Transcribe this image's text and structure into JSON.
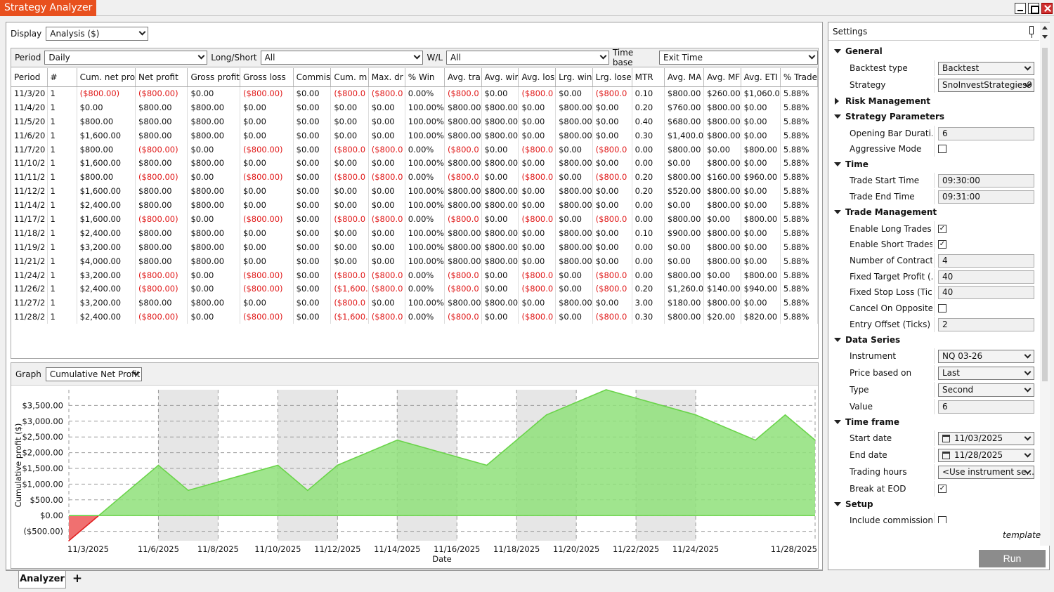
{
  "window": {
    "title": "Strategy Analyzer"
  },
  "display": {
    "label": "Display",
    "value": "Analysis ($)"
  },
  "filters": {
    "period_label": "Period",
    "period_value": "Daily",
    "longshort_label": "Long/Short",
    "longshort_value": "All",
    "wl_label": "W/L",
    "wl_value": "All",
    "timebase_label": "Time base",
    "timebase_value": "Exit Time"
  },
  "table": {
    "columns": [
      "Period",
      "#",
      "Cum. net pro",
      "Net profit",
      "Gross profit",
      "Gross loss",
      "Commis",
      "Cum. m",
      "Max. dr",
      "% Win",
      "Avg. tra",
      "Avg. wir",
      "Avg. los",
      "Lrg. win",
      "Lrg. lose",
      "MTR",
      "Avg. MA",
      "Avg. MF",
      "Avg. ETI",
      "% Trade"
    ],
    "rows": [
      [
        "11/3/20",
        "1",
        "($800.00)",
        "($800.00)",
        "$0.00",
        "($800.00)",
        "$0.00",
        "($800.0",
        "($800.0",
        "0.00%",
        "($800.0",
        "$0.00",
        "($800.0",
        "$0.00",
        "($800.0",
        "0.10",
        "$800.00",
        "$260.00",
        "$1,060.0",
        "5.88%"
      ],
      [
        "11/4/20",
        "1",
        "$0.00",
        "$800.00",
        "$800.00",
        "$0.00",
        "$0.00",
        "$0.00",
        "$0.00",
        "100.00%",
        "$800.00",
        "$800.00",
        "$0.00",
        "$800.00",
        "$0.00",
        "0.20",
        "$760.00",
        "$800.00",
        "$0.00",
        "5.88%"
      ],
      [
        "11/5/20",
        "1",
        "$800.00",
        "$800.00",
        "$800.00",
        "$0.00",
        "$0.00",
        "$0.00",
        "$0.00",
        "100.00%",
        "$800.00",
        "$800.00",
        "$0.00",
        "$800.00",
        "$0.00",
        "0.40",
        "$680.00",
        "$800.00",
        "$0.00",
        "5.88%"
      ],
      [
        "11/6/20",
        "1",
        "$1,600.00",
        "$800.00",
        "$800.00",
        "$0.00",
        "$0.00",
        "$0.00",
        "$0.00",
        "100.00%",
        "$800.00",
        "$800.00",
        "$0.00",
        "$800.00",
        "$0.00",
        "0.30",
        "$1,400.0",
        "$800.00",
        "$0.00",
        "5.88%"
      ],
      [
        "11/7/20",
        "1",
        "$800.00",
        "($800.00)",
        "$0.00",
        "($800.00)",
        "$0.00",
        "($800.0",
        "($800.0",
        "0.00%",
        "($800.0",
        "$0.00",
        "($800.0",
        "$0.00",
        "($800.0",
        "0.00",
        "$800.00",
        "$0.00",
        "$800.00",
        "5.88%"
      ],
      [
        "11/10/2",
        "1",
        "$1,600.00",
        "$800.00",
        "$800.00",
        "$0.00",
        "$0.00",
        "$0.00",
        "$0.00",
        "100.00%",
        "$800.00",
        "$800.00",
        "$0.00",
        "$800.00",
        "$0.00",
        "0.00",
        "$0.00",
        "$800.00",
        "$0.00",
        "5.88%"
      ],
      [
        "11/11/2",
        "1",
        "$800.00",
        "($800.00)",
        "$0.00",
        "($800.00)",
        "$0.00",
        "($800.0",
        "($800.0",
        "0.00%",
        "($800.0",
        "$0.00",
        "($800.0",
        "$0.00",
        "($800.0",
        "0.20",
        "$800.00",
        "$160.00",
        "$960.00",
        "5.88%"
      ],
      [
        "11/12/2",
        "1",
        "$1,600.00",
        "$800.00",
        "$800.00",
        "$0.00",
        "$0.00",
        "$0.00",
        "$0.00",
        "100.00%",
        "$800.00",
        "$800.00",
        "$0.00",
        "$800.00",
        "$0.00",
        "0.20",
        "$520.00",
        "$800.00",
        "$0.00",
        "5.88%"
      ],
      [
        "11/14/2",
        "1",
        "$2,400.00",
        "$800.00",
        "$800.00",
        "$0.00",
        "$0.00",
        "$0.00",
        "$0.00",
        "100.00%",
        "$800.00",
        "$800.00",
        "$0.00",
        "$800.00",
        "$0.00",
        "0.00",
        "$0.00",
        "$800.00",
        "$0.00",
        "5.88%"
      ],
      [
        "11/17/2",
        "1",
        "$1,600.00",
        "($800.00)",
        "$0.00",
        "($800.00)",
        "$0.00",
        "($800.0",
        "($800.0",
        "0.00%",
        "($800.0",
        "$0.00",
        "($800.0",
        "$0.00",
        "($800.0",
        "0.00",
        "$800.00",
        "$0.00",
        "$800.00",
        "5.88%"
      ],
      [
        "11/18/2",
        "1",
        "$2,400.00",
        "$800.00",
        "$800.00",
        "$0.00",
        "$0.00",
        "$0.00",
        "$0.00",
        "100.00%",
        "$800.00",
        "$800.00",
        "$0.00",
        "$800.00",
        "$0.00",
        "0.10",
        "$900.00",
        "$800.00",
        "$0.00",
        "5.88%"
      ],
      [
        "11/19/2",
        "1",
        "$3,200.00",
        "$800.00",
        "$800.00",
        "$0.00",
        "$0.00",
        "$0.00",
        "$0.00",
        "100.00%",
        "$800.00",
        "$800.00",
        "$0.00",
        "$800.00",
        "$0.00",
        "0.00",
        "$0.00",
        "$800.00",
        "$0.00",
        "5.88%"
      ],
      [
        "11/21/2",
        "1",
        "$4,000.00",
        "$800.00",
        "$800.00",
        "$0.00",
        "$0.00",
        "$0.00",
        "$0.00",
        "100.00%",
        "$800.00",
        "$800.00",
        "$0.00",
        "$800.00",
        "$0.00",
        "0.00",
        "$0.00",
        "$800.00",
        "$0.00",
        "5.88%"
      ],
      [
        "11/24/2",
        "1",
        "$3,200.00",
        "($800.00)",
        "$0.00",
        "($800.00)",
        "$0.00",
        "($800.0",
        "($800.0",
        "0.00%",
        "($800.0",
        "$0.00",
        "($800.0",
        "$0.00",
        "($800.0",
        "0.00",
        "$800.00",
        "$0.00",
        "$800.00",
        "5.88%"
      ],
      [
        "11/26/2",
        "1",
        "$2,400.00",
        "($800.00)",
        "$0.00",
        "($800.00)",
        "$0.00",
        "($1,600.",
        "($800.0",
        "0.00%",
        "($800.0",
        "$0.00",
        "($800.0",
        "$0.00",
        "($800.0",
        "0.20",
        "$1,260.0",
        "$140.00",
        "$940.00",
        "5.88%"
      ],
      [
        "11/27/2",
        "1",
        "$3,200.00",
        "$800.00",
        "$800.00",
        "$0.00",
        "$0.00",
        "($800.0",
        "$0.00",
        "100.00%",
        "$800.00",
        "$800.00",
        "$0.00",
        "$800.00",
        "$0.00",
        "3.00",
        "$180.00",
        "$800.00",
        "$0.00",
        "5.88%"
      ],
      [
        "11/28/2",
        "1",
        "$2,400.00",
        "($800.00)",
        "$0.00",
        "($800.00)",
        "$0.00",
        "($1,600.",
        "($800.0",
        "0.00%",
        "($800.0",
        "$0.00",
        "($800.0",
        "$0.00",
        "($800.0",
        "0.30",
        "$800.00",
        "$20.00",
        "$820.00",
        "5.88%"
      ]
    ]
  },
  "graph": {
    "label": "Graph",
    "value": "Cumulative Net Profit"
  },
  "chart_data": {
    "type": "area",
    "ylabel": "Cumulative profit ($)",
    "xlabel": "Date",
    "x": [
      "11/3/2025",
      "11/4/2025",
      "11/5/2025",
      "11/6/2025",
      "11/7/2025",
      "11/10/2025",
      "11/11/2025",
      "11/12/2025",
      "11/14/2025",
      "11/17/2025",
      "11/18/2025",
      "11/19/2025",
      "11/21/2025",
      "11/24/2025",
      "11/26/2025",
      "11/27/2025",
      "11/28/2025"
    ],
    "values": [
      -800,
      0,
      800,
      1600,
      800,
      1600,
      800,
      1600,
      2400,
      1600,
      2400,
      3200,
      4000,
      3200,
      2400,
      3200,
      2400
    ],
    "x_tick_labels": [
      "11/3/2025",
      "11/6/2025",
      "11/8/2025",
      "11/10/2025",
      "11/12/2025",
      "11/14/2025",
      "11/16/2025",
      "11/18/2025",
      "11/20/2025",
      "11/22/2025",
      "11/24/2025",
      "11/28/2025"
    ],
    "y_tick_labels": [
      "$3,500.00",
      "$3,000.00",
      "$2,500.00",
      "$2,000.00",
      "$1,500.00",
      "$1,000.00",
      "$500.00",
      "$0.00",
      "($500.00)"
    ],
    "y_ticks": [
      3500,
      3000,
      2500,
      2000,
      1500,
      1000,
      500,
      0,
      -500
    ],
    "ylim": [
      -800,
      4000
    ],
    "grid": true,
    "positive_color": "#8fe07a",
    "positive_line": "#6ad44a",
    "negative_color": "#f07070",
    "negative_line": "#e02020",
    "shade_color": "#e6e6e6"
  },
  "tabs": {
    "analyzer": "Analyzer",
    "add": "+"
  },
  "settings": {
    "title": "Settings",
    "template_label": "template",
    "run_label": "Run",
    "items": [
      {
        "kind": "section",
        "label": "General"
      },
      {
        "kind": "combo",
        "label": "Backtest type",
        "value": "Backtest"
      },
      {
        "kind": "combo",
        "label": "Strategy",
        "value": "SnoInvestStrategies9"
      },
      {
        "kind": "section-collapsed",
        "label": "Risk Management"
      },
      {
        "kind": "section",
        "label": "Strategy Parameters"
      },
      {
        "kind": "text",
        "label": "Opening Bar Durati...",
        "value": "6"
      },
      {
        "kind": "check",
        "label": "Aggressive Mode",
        "value": ""
      },
      {
        "kind": "section",
        "label": "Time"
      },
      {
        "kind": "text",
        "label": "Trade Start Time",
        "value": "09:30:00"
      },
      {
        "kind": "text",
        "label": "Trade End Time",
        "value": "09:31:00"
      },
      {
        "kind": "section",
        "label": "Trade Management"
      },
      {
        "kind": "check",
        "label": "Enable Long Trades",
        "value": "✓"
      },
      {
        "kind": "check",
        "label": "Enable Short Trades",
        "value": "✓"
      },
      {
        "kind": "text",
        "label": "Number of Contracts",
        "value": "4"
      },
      {
        "kind": "text",
        "label": "Fixed Target Profit (...",
        "value": "40"
      },
      {
        "kind": "text",
        "label": "Fixed Stop Loss (Tic...",
        "value": "40"
      },
      {
        "kind": "check",
        "label": "Cancel On Opposite...",
        "value": ""
      },
      {
        "kind": "text",
        "label": "Entry Offset (Ticks)",
        "value": "2"
      },
      {
        "kind": "section",
        "label": "Data Series"
      },
      {
        "kind": "combo",
        "label": "Instrument",
        "value": "NQ 03-26"
      },
      {
        "kind": "combo",
        "label": "Price based on",
        "value": "Last"
      },
      {
        "kind": "combo",
        "label": "Type",
        "value": "Second"
      },
      {
        "kind": "text",
        "label": "Value",
        "value": "6"
      },
      {
        "kind": "section",
        "label": "Time frame"
      },
      {
        "kind": "date",
        "label": "Start date",
        "value": "11/03/2025"
      },
      {
        "kind": "date",
        "label": "End date",
        "value": "11/28/2025"
      },
      {
        "kind": "combo",
        "label": "Trading hours",
        "value": "<Use instrument se..."
      },
      {
        "kind": "check",
        "label": "Break at EOD",
        "value": "✓"
      },
      {
        "kind": "section",
        "label": "Setup"
      },
      {
        "kind": "check",
        "label": "Include commission",
        "value": ""
      }
    ]
  }
}
